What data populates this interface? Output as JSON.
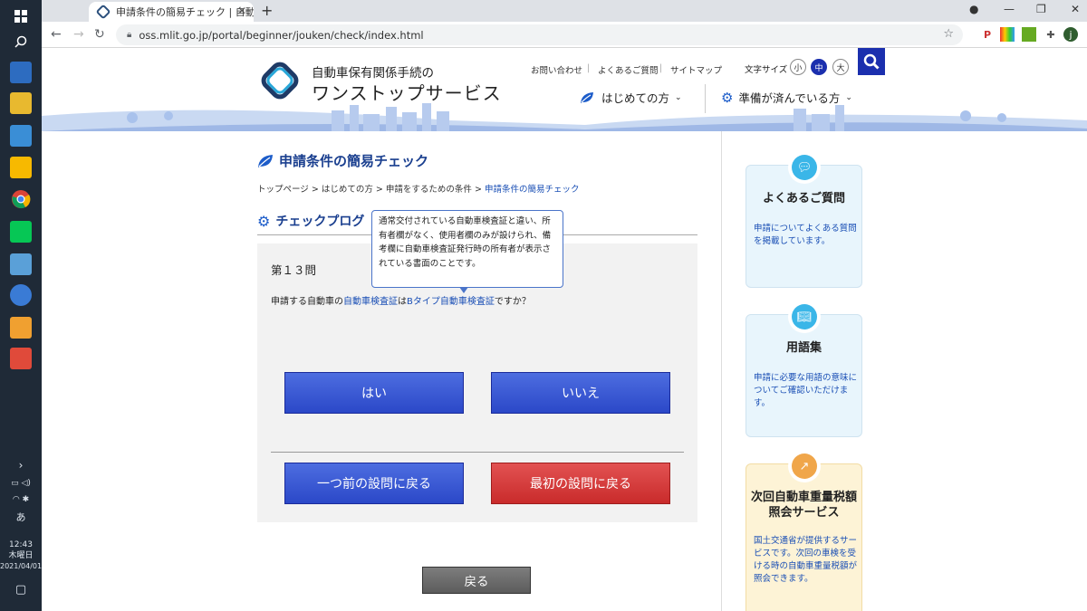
{
  "browser": {
    "tab_title": "申請条件の簡易チェック | 自動車保",
    "url": "oss.mlit.go.jp/portal/beginner/jouken/check/index.html",
    "profile_initial": "j"
  },
  "taskbar": {
    "time": "12:43",
    "weekday": "木曜日",
    "date": "2021/04/01",
    "ime": "あ"
  },
  "header": {
    "logo_sub": "自動車保有関係手続の",
    "logo_main": "ワンストップサービス",
    "links": [
      "お問い合わせ",
      "よくあるご質問",
      "サイトマップ"
    ],
    "font_size_label": "文字サイズ",
    "font_sizes": [
      "小",
      "中",
      "大"
    ],
    "menu_beginner": "はじめての方",
    "menu_ready": "準備が済んでいる方"
  },
  "main": {
    "title": "申請条件の簡易チェック",
    "breadcrumb": [
      "トップページ",
      "はじめての方",
      "申請をするための条件",
      "申請条件の簡易チェック"
    ],
    "breadcrumb_sep": ">",
    "section_title": "チェックプログ",
    "question_number": "第１３問",
    "question_pre": "申請する自動車の",
    "question_link1": "自動車検査証",
    "question_mid": "は",
    "question_link2": "Bタイプ自動車検査証",
    "question_post": "ですか？",
    "yes_label": "はい",
    "no_label": "いいえ",
    "prev_label": "一つ前の設問に戻る",
    "first_label": "最初の設問に戻る",
    "back_label": "戻る",
    "tooltip": "通常交付されている自動車検査証と違い、所有者欄がなく、使用者欄のみが設けられ、備考欄に自動車検査証発行時の所有者が表示されている書面のことです。"
  },
  "sidebar": {
    "faq_title": "よくあるご質問",
    "faq_desc": "申請についてよくある質問を掲載しています。",
    "glossary_title": "用語集",
    "glossary_desc": "申請に必要な用語の意味についてご確認いただけます。",
    "tax_title": "次回自動車重量税額照会サービス",
    "tax_desc": "国土交通省が提供するサービスです。次回の車検を受ける時の自動車重量税額が照会できます。"
  },
  "colors": {
    "brand_blue": "#1a3f8f",
    "button_blue": "#2b48c8",
    "button_red": "#c92b2b",
    "link_blue": "#1a4fb5"
  }
}
